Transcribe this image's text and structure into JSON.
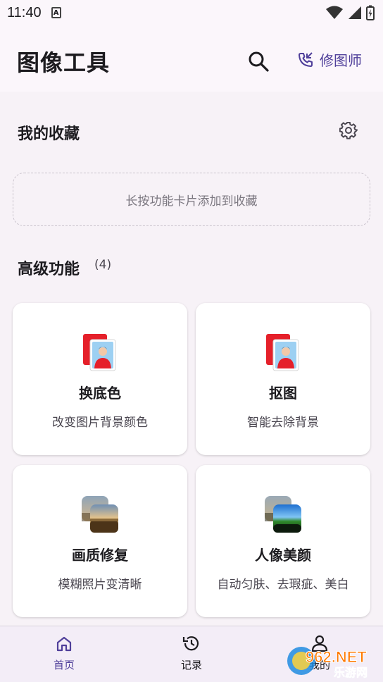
{
  "status_bar": {
    "time": "11:40"
  },
  "app_bar": {
    "title": "图像工具",
    "retouch_label": "修图师"
  },
  "favorites": {
    "title": "我的收藏",
    "empty_hint": "长按功能卡片添加到收藏"
  },
  "advanced": {
    "title": "高级功能",
    "count": "(4)",
    "cards": [
      {
        "name": "换底色",
        "desc": "改变图片背景颜色",
        "icon": "portrait-icon"
      },
      {
        "name": "抠图",
        "desc": "智能去除背景",
        "icon": "portrait-icon"
      },
      {
        "name": "画质修复",
        "desc": "模糊照片变清晰",
        "icon": "landscape-icon"
      },
      {
        "name": "人像美颜",
        "desc": "自动匀肤、去瑕疵、美白",
        "icon": "landscape-icon"
      }
    ]
  },
  "bottom_nav": {
    "items": [
      {
        "label": "首页",
        "icon": "home-icon",
        "active": true
      },
      {
        "label": "记录",
        "icon": "history-icon",
        "active": false
      },
      {
        "label": "我的",
        "icon": "profile-icon",
        "active": false
      }
    ]
  },
  "watermark": {
    "text": "962.NET",
    "subtext": "乐游网"
  },
  "colors": {
    "accent": "#4f3f9a",
    "background": "#f7f2f7",
    "card": "#ffffff",
    "nav_bg": "#f3edf7"
  }
}
